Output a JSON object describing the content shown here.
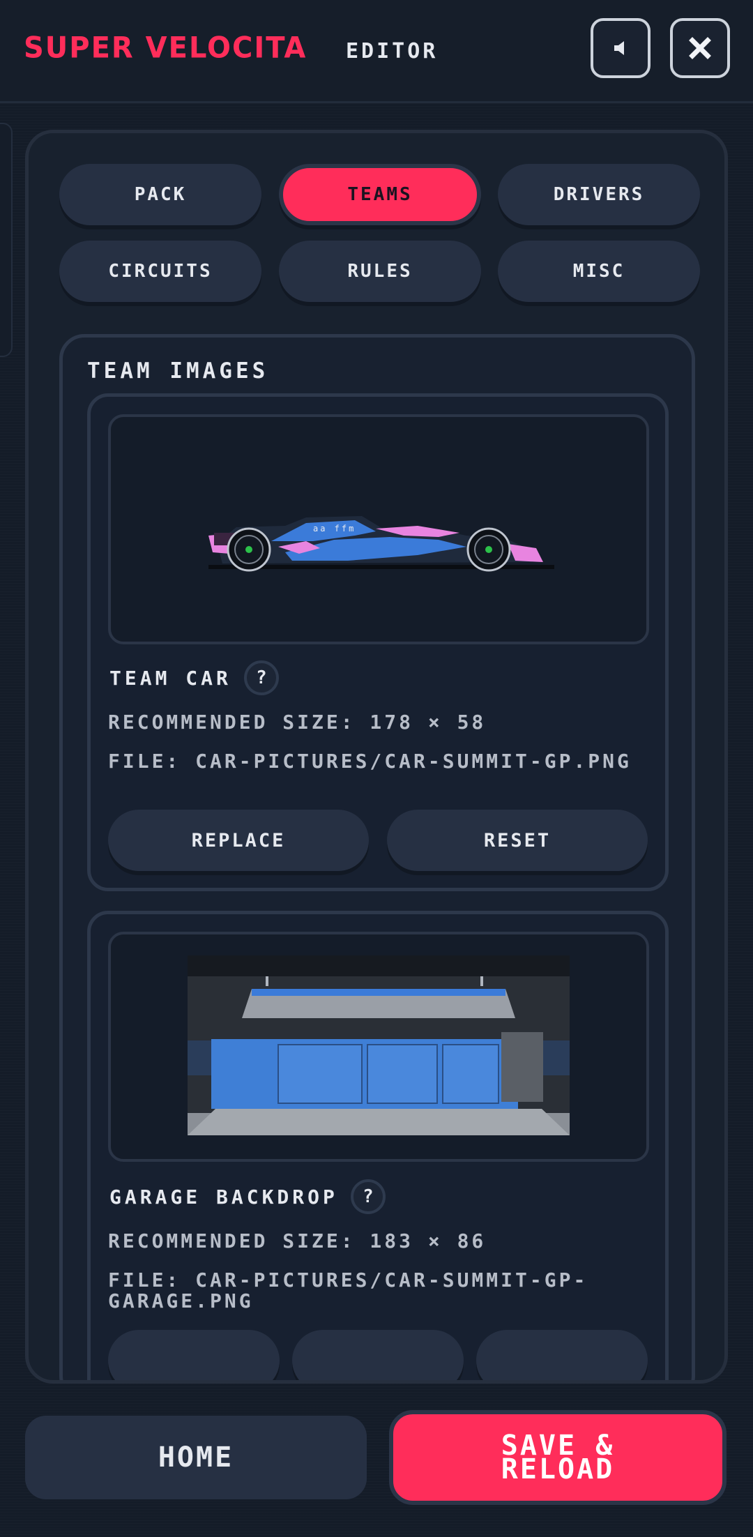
{
  "header": {
    "brand": "SUPER VELOCITA",
    "section": "EDITOR",
    "sound_icon": "speaker-icon",
    "close_icon": "close-icon"
  },
  "tabs": [
    {
      "label": "PACK",
      "active": false
    },
    {
      "label": "TEAMS",
      "active": true
    },
    {
      "label": "DRIVERS",
      "active": false
    },
    {
      "label": "CIRCUITS",
      "active": false
    },
    {
      "label": "RULES",
      "active": false
    },
    {
      "label": "MISC",
      "active": false
    }
  ],
  "team_images": {
    "title": "TEAM IMAGES",
    "items": [
      {
        "title": "TEAM CAR",
        "help": "?",
        "size": "RECOMMENDED SIZE: 178 × 58",
        "file": "FILE: CAR-PICTURES/CAR-SUMMIT-GP.PNG",
        "buttons": [
          "REPLACE",
          "RESET"
        ]
      },
      {
        "title": "GARAGE BACKDROP",
        "help": "?",
        "size": "RECOMMENDED SIZE: 183 × 86",
        "file": "FILE: CAR-PICTURES/CAR-SUMMIT-GP-GARAGE.PNG"
      }
    ]
  },
  "footer": {
    "home": "HOME",
    "save": "SAVE &\nRELOAD"
  },
  "colors": {
    "accent": "#ff2d5a",
    "background": "#141c28",
    "button": "#263043"
  }
}
